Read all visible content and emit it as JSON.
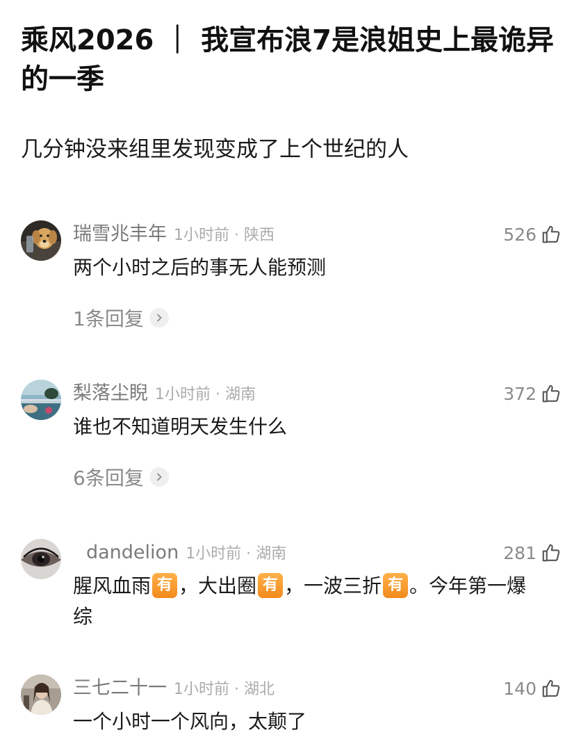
{
  "post": {
    "title": "乘风2026 ｜ 我宣布浪7是浪姐史上最诡异的一季",
    "body": "几分钟没来组里发现变成了上个世纪的人"
  },
  "comments": [
    {
      "username": "瑞雪兆丰年",
      "time_location": "1小时前 · 陕西",
      "likes": "526",
      "text": "两个小时之后的事无人能预测",
      "replies": "1条回复",
      "avatar_icon": "dog-avatar"
    },
    {
      "username": "梨落尘睨",
      "time_location": "1小时前 · 湖南",
      "likes": "372",
      "text": "谁也不知道明天发生什么",
      "replies": "6条回复",
      "avatar_icon": "seaside-avatar"
    },
    {
      "username": "dandelion",
      "time_location": "1小时前 · 湖南",
      "likes": "281",
      "text_parts": [
        "腥风血雨",
        "，大出圈",
        "，一波三折",
        "。今年第一爆综"
      ],
      "emoji_label": "有",
      "avatar_icon": "eye-avatar"
    },
    {
      "username": "三七二十一",
      "time_location": "1小时前 · 湖北",
      "likes": "140",
      "text": "一个小时一个风向，太颠了",
      "avatar_icon": "portrait-avatar"
    }
  ],
  "icons": {
    "like": "thumbs-up-icon",
    "replies_arrow": "chevron-right-icon"
  },
  "colors": {
    "emoji_badge": "#f28a1c",
    "meta_text": "#7a7a7a"
  }
}
